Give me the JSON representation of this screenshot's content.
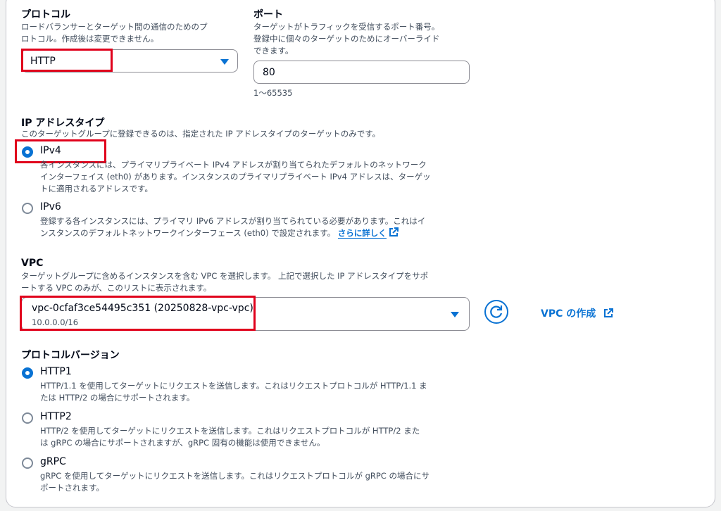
{
  "protocol": {
    "label": "プロトコル",
    "description_line1": "ロードバランサーとターゲット間の通信のためのプ",
    "description_line2": "ロトコル。作成後は変更できません。",
    "selected": "HTTP"
  },
  "port": {
    "label": "ポート",
    "description_line1": "ターゲットがトラフィックを受信するポート番号。",
    "description_line2": "登録中に個々のターゲットのためにオーバーライド",
    "description_line3": "できます。",
    "value": "80",
    "constraint": "1〜65535"
  },
  "ip_address_type": {
    "label": "IP アドレスタイプ",
    "description": "このターゲットグループに登録できるのは、指定された IP アドレスタイプのターゲットのみです。",
    "options": [
      {
        "label": "IPv4",
        "selected": true,
        "desc_line1": "各インスタンスには、プライマリプライベート IPv4 アドレスが割り当てられたデフォルトのネットワーク",
        "desc_line2": "インターフェイス (eth0) があります。インスタンスのプライマリプライベート IPv4 アドレスは、ターゲッ",
        "desc_line3": "トに適用されるアドレスです。"
      },
      {
        "label": "IPv6",
        "selected": false,
        "desc_line1": "登録する各インスタンスには、プライマリ IPv6 アドレスが割り当てられている必要があります。これはイ",
        "desc_line2": "ンスタンスのデフォルトネットワークインターフェース (eth0) で設定されます。",
        "link": "さらに詳しく"
      }
    ]
  },
  "vpc": {
    "label": "VPC",
    "description_line1": "ターゲットグループに含めるインスタンスを含む VPC を選択します。 上記で選択した IP アドレスタイプをサポ",
    "description_line2": "ートする VPC のみが、このリストに表示されます。",
    "selected": "vpc-0cfaf3ce54495c351 (20250828-vpc-vpc)",
    "selected_cidr": "10.0.0.0/16",
    "create_link": "VPC の作成"
  },
  "protocol_version": {
    "label": "プロトコルバージョン",
    "options": [
      {
        "label": "HTTP1",
        "selected": true,
        "desc_line1": "HTTP/1.1 を使用してターゲットにリクエストを送信します。これはリクエストプロトコルが HTTP/1.1 ま",
        "desc_line2": "たは HTTP/2 の場合にサポートされます。"
      },
      {
        "label": "HTTP2",
        "selected": false,
        "desc_line1": "HTTP/2 を使用してターゲットにリクエストを送信します。これはリクエストプロトコルが HTTP/2 また",
        "desc_line2": "は gRPC の場合にサポートされますが、gRPC 固有の機能は使用できません。"
      },
      {
        "label": "gRPC",
        "selected": false,
        "desc_line1": "gRPC を使用してターゲットにリクエストを送信します。これはリクエストプロトコルが gRPC の場合にサ",
        "desc_line2": "ポートされます。"
      }
    ]
  },
  "colors": {
    "accent": "#0972d3",
    "highlight_box": "#e0001b",
    "text": "#000716",
    "secondary_text": "#414d5c"
  }
}
